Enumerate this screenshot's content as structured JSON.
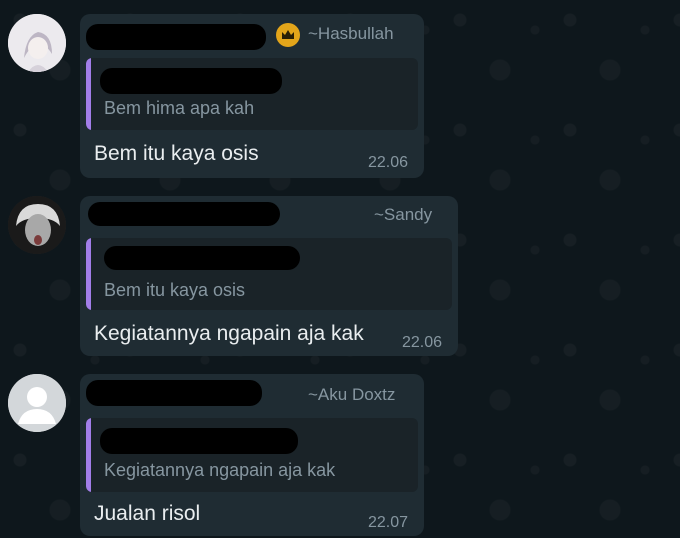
{
  "messages": [
    {
      "sender": "~Hasbullah",
      "sender_badge": "crown-icon",
      "quoted_text": "Bem hima apa kah",
      "text": "Bem itu kaya osis",
      "time": "22.06"
    },
    {
      "sender": "~Sandy",
      "quoted_text": "Bem itu kaya osis",
      "text": "Kegiatannya ngapain aja kak",
      "time": "22.06"
    },
    {
      "sender": "~Aku Doxtz",
      "quoted_text": "Kegiatannya ngapain aja kak",
      "text": "Jualan risol",
      "time": "22.07"
    }
  ],
  "colors": {
    "background": "#0b141a",
    "bubble": "#1f2c33",
    "quote_bar": "#a27ee9",
    "badge": "#e3a51a"
  }
}
